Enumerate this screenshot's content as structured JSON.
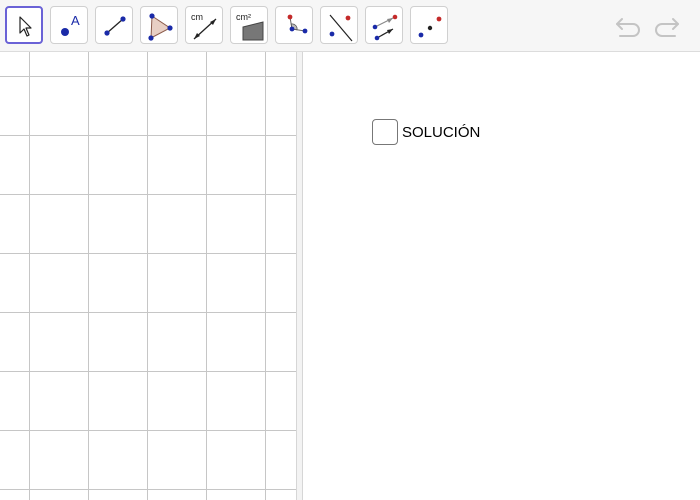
{
  "toolbar": {
    "tools": [
      {
        "name": "move-tool",
        "icon": "cursor-arrow-icon"
      },
      {
        "name": "point-tool",
        "icon": "point-with-label-icon",
        "label": "A"
      },
      {
        "name": "segment-tool",
        "icon": "segment-icon"
      },
      {
        "name": "polygon-tool",
        "icon": "triangle-icon"
      },
      {
        "name": "distance-tool",
        "icon": "distance-length-icon",
        "label": "cm"
      },
      {
        "name": "area-tool",
        "icon": "area-icon",
        "label": "cm²"
      },
      {
        "name": "angle-tool",
        "icon": "angle-icon"
      },
      {
        "name": "perpendicular-line-tool",
        "icon": "perpendicular-line-icon"
      },
      {
        "name": "vector-tool",
        "icon": "translate-by-vector-icon"
      },
      {
        "name": "point-reflect-tool",
        "icon": "reflect-about-point-icon"
      }
    ],
    "undo_icon": "undo-icon",
    "redo_icon": "redo-icon"
  },
  "colors": {
    "accent": "#6a62d6",
    "point_blue": "#1a2aa8",
    "point_red": "#c42a2a",
    "grid": "#c6c6c6"
  },
  "panel": {
    "checkbox_label": "SOLUCIÓN",
    "checkbox_checked": false
  }
}
